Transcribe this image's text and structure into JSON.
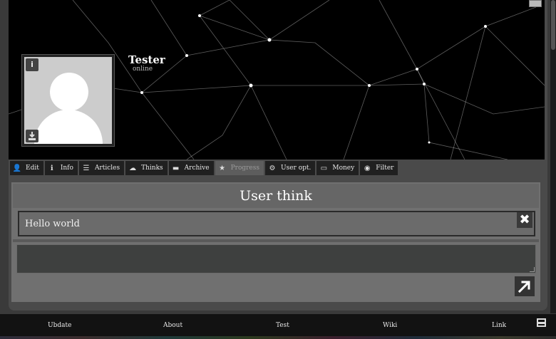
{
  "profile": {
    "name": "Tester",
    "status": "online",
    "info_glyph": "i"
  },
  "tabs": [
    {
      "label": "Edit",
      "icon": "user-icon",
      "glyph": "👤",
      "active": false
    },
    {
      "label": "Info",
      "icon": "info-icon",
      "glyph": "ℹ",
      "active": false
    },
    {
      "label": "Articles",
      "icon": "list-icon",
      "glyph": "☰",
      "active": false
    },
    {
      "label": "Thinks",
      "icon": "cloud-icon",
      "glyph": "☁",
      "active": false
    },
    {
      "label": "Archive",
      "icon": "folder-icon",
      "glyph": "▬",
      "active": false
    },
    {
      "label": "Progress",
      "icon": "star-icon",
      "glyph": "★",
      "active": true
    },
    {
      "label": "User opt.",
      "icon": "gears-icon",
      "glyph": "⚙",
      "active": false
    },
    {
      "label": "Money",
      "icon": "credit-card-icon",
      "glyph": "▭",
      "active": false
    },
    {
      "label": "Filter",
      "icon": "eye-slash-icon",
      "glyph": "◉",
      "active": false
    }
  ],
  "panel": {
    "title": "User think",
    "think_text": "Hello world",
    "close_glyph": "✖",
    "textarea_value": ""
  },
  "footer": {
    "links": [
      "Ubdate",
      "About",
      "Test",
      "Wiki",
      "Link"
    ]
  },
  "colors": {
    "banner_bg": "#000000",
    "panel_bg": "#707070",
    "tab_bg": "#202020",
    "active_tab_bg": "#5d5d5d"
  }
}
